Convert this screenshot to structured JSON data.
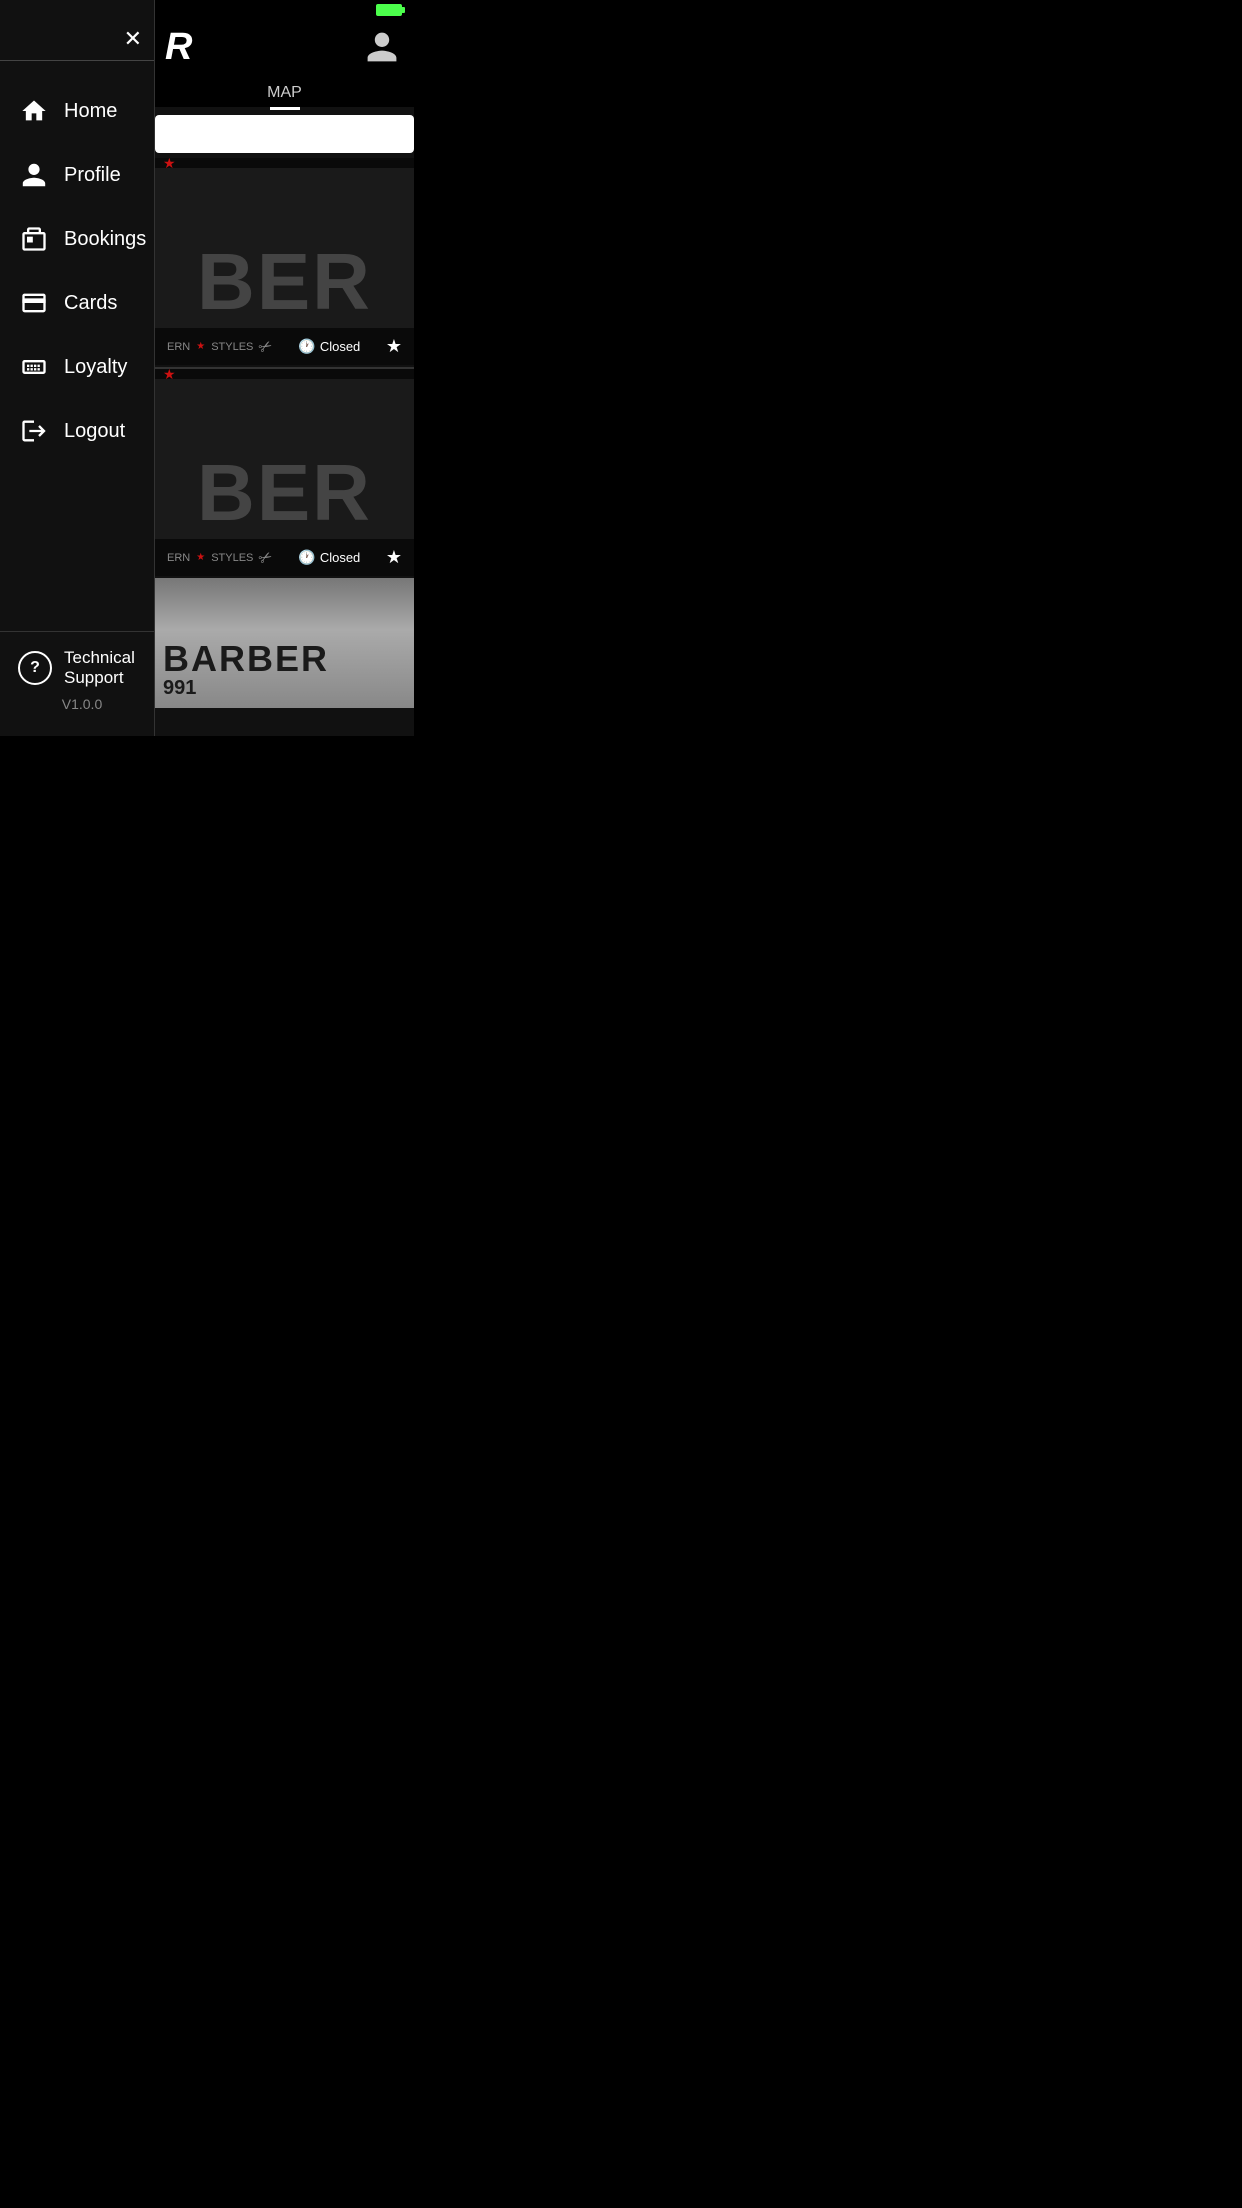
{
  "statusBar": {
    "batteryColor": "#4cff4c"
  },
  "sidebar": {
    "closeLabel": "×",
    "navItems": [
      {
        "id": "home",
        "label": "Home",
        "icon": "home-icon"
      },
      {
        "id": "profile",
        "label": "Profile",
        "icon": "profile-icon"
      },
      {
        "id": "bookings",
        "label": "Bookings",
        "icon": "bookings-icon"
      },
      {
        "id": "cards",
        "label": "Cards",
        "icon": "cards-icon"
      },
      {
        "id": "loyalty",
        "label": "Loyalty",
        "icon": "loyalty-icon"
      },
      {
        "id": "logout",
        "label": "Logout",
        "icon": "logout-icon"
      }
    ],
    "footer": {
      "techSupport": "Technical Support",
      "version": "V1.0.0"
    }
  },
  "mainContent": {
    "brandLetter": "R",
    "mapLabel": "MAP",
    "barberCards": [
      {
        "bgText": "BER",
        "tagText": "ERN  ✦  STYLES",
        "closedLabel": "Closed",
        "favorited": true
      },
      {
        "bgText": "BER",
        "tagText": "ERN  ✦  STYLES",
        "closedLabel": "Closed",
        "favorited": true
      },
      {
        "photoLabel": "BARBER",
        "subLabel": "991"
      }
    ]
  }
}
